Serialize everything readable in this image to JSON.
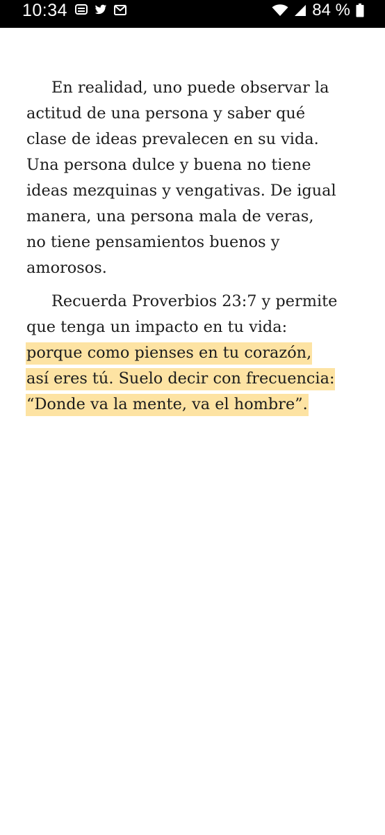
{
  "status_bar": {
    "time": "10:34",
    "notification_icons": [
      "message-icon",
      "twitter-icon",
      "gmail-icon"
    ],
    "system_icons": [
      "wifi-icon",
      "signal-icon",
      "battery-icon"
    ],
    "battery_percent": "84 %"
  },
  "reader": {
    "paragraph_1": {
      "lines": [
        "En realidad, uno puede observar la",
        "actitud de una persona y saber qué",
        "clase de ideas prevalecen en su vida.",
        "Una persona dulce y buena no tiene",
        "ideas mezquinas y vengativas. De igual",
        "manera, una persona mala de veras,",
        "no tiene pensamientos buenos y",
        "amorosos."
      ]
    },
    "paragraph_2": {
      "lines": [
        "Recuerda Proverbios 23:7 y permite",
        "que tenga un impacto en tu vida:"
      ],
      "highlighted_lines": [
        "porque como pienses en tu corazón,",
        "así eres tú. Suelo decir con frecuencia:",
        "“Donde va la mente, va el hombre”."
      ]
    },
    "highlight_color": "#fde3a3",
    "text_color": "#1c1c1c",
    "background_color": "#ffffff"
  }
}
